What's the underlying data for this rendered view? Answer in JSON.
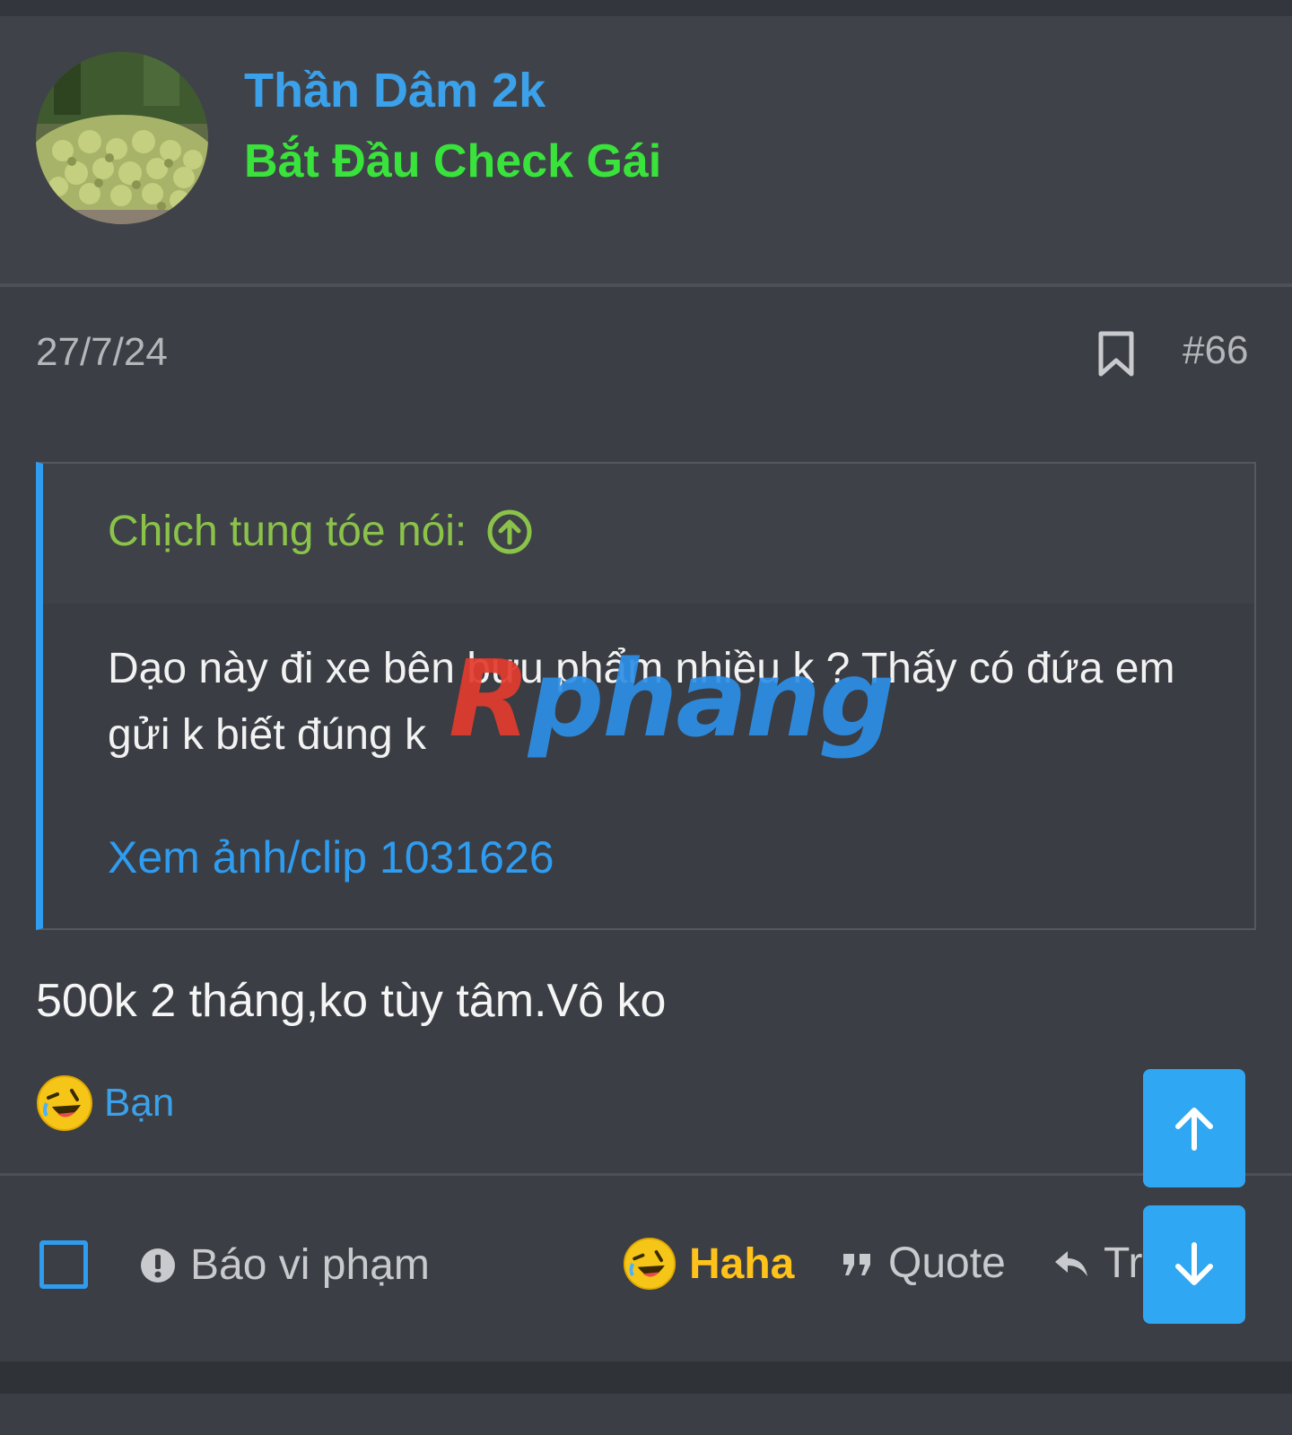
{
  "user": {
    "name": "Thần Dâm 2k",
    "title": "Bắt Đầu Check Gái"
  },
  "post": {
    "date": "27/7/24",
    "number": "#66",
    "body": "500k 2 tháng,ko tùy tâm.Vô ko"
  },
  "quote": {
    "author": "Chịch tung tóe nói:",
    "text": "Dạo này đi xe bên bưu phẩm nhiều k ? Thấy có đứa em gửi k biết đúng k",
    "link": "Xem ảnh/clip 1031626"
  },
  "watermark": {
    "first": "R",
    "rest": "phang"
  },
  "reactions": {
    "summary": "Bạn"
  },
  "actions": {
    "report": "Báo vi phạm",
    "haha": "Haha",
    "quote": "Quote",
    "reply": "Trả lời"
  },
  "colors": {
    "accent": "#2f9cf0",
    "username": "#3ba1ea",
    "usertitle": "#39e33b",
    "quote_author": "#8bc34a",
    "haha": "#ffc21a",
    "background": "#3b3e44"
  }
}
